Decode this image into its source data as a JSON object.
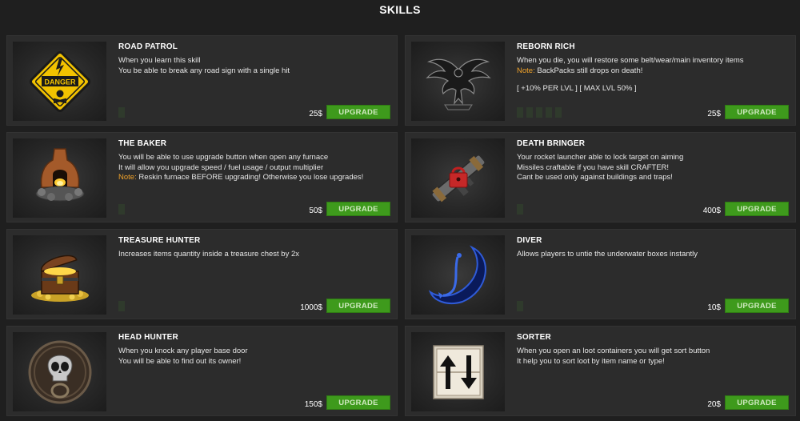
{
  "title": "SKILLS",
  "cards": [
    {
      "name": "ROAD PATROL",
      "lines": [
        "When you learn this skill",
        "You be able to break any road sign with a single hit"
      ],
      "price": "25$",
      "button": "UPGRADE",
      "icon": "danger-sign-icon"
    },
    {
      "name": "REBORN RICH",
      "lines": [
        "When you die, you will restore some belt/wear/main inventory items"
      ],
      "note_label": "Note:",
      "note_text": " BackPacks still drops on death!",
      "extra": "[ +10% PER LVL ] [ MAX LVL 50% ]",
      "price": "25$",
      "button": "UPGRADE",
      "icon": "phoenix-icon"
    },
    {
      "name": "THE BAKER",
      "lines": [
        "You will be able to use upgrade button when open any furnace",
        "It will allow you upgrade speed / fuel usage / output multiplier"
      ],
      "note_label": "Note:",
      "note_text": " Reskin furnace BEFORE upgrading! Otherwise you lose upgrades!",
      "price": "50$",
      "button": "UPGRADE",
      "icon": "furnace-icon"
    },
    {
      "name": "DEATH BRINGER",
      "lines": [
        "Your rocket launcher able to lock target on aiming",
        "Missiles craftable if you have skill CRAFTER!",
        "Cant be used only against buildings and traps!"
      ],
      "price": "400$",
      "button": "UPGRADE",
      "icon": "rocket-launcher-icon"
    },
    {
      "name": "TREASURE HUNTER",
      "lines": [
        "Increases items quantity inside a treasure chest by 2x"
      ],
      "price": "1000$",
      "button": "UPGRADE",
      "icon": "treasure-chest-icon"
    },
    {
      "name": "DIVER",
      "lines": [
        "Allows players to untie the underwater boxes instantly"
      ],
      "price": "10$",
      "button": "UPGRADE",
      "icon": "diver-icon"
    },
    {
      "name": "HEAD HUNTER",
      "lines": [
        "When you knock any player base door",
        "You will be able to find out its owner!"
      ],
      "price": "150$",
      "button": "UPGRADE",
      "icon": "skull-knocker-icon"
    },
    {
      "name": "SORTER",
      "lines": [
        "When you open an loot containers you will get sort button",
        "It help you to sort loot by item name or type!"
      ],
      "price": "20$",
      "button": "UPGRADE",
      "icon": "sort-arrows-icon"
    }
  ]
}
